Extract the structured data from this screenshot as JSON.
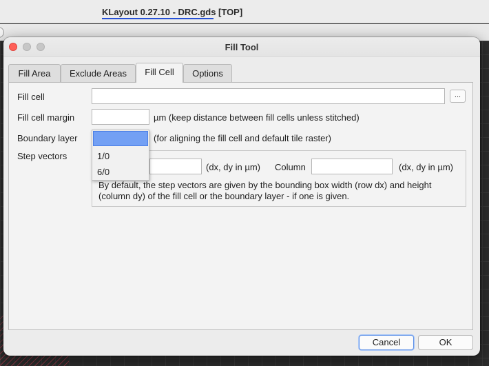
{
  "window": {
    "title": "KLayout 0.27.10 - DRC.gds [TOP]"
  },
  "dialog": {
    "title": "Fill Tool",
    "tabs": [
      "Fill Area",
      "Exclude Areas",
      "Fill Cell",
      "Options"
    ],
    "active_tab": "Fill Cell",
    "fill_cell": {
      "label": "Fill cell",
      "value": "",
      "browse_label": "..."
    },
    "fill_cell_margin": {
      "label": "Fill cell margin",
      "value": "",
      "hint": "µm (keep distance between fill cells unless stitched)"
    },
    "boundary_layer": {
      "label": "Boundary layer",
      "selected": "",
      "hint": "(for aligning the fill cell and default tile raster)",
      "options": [
        "1/0",
        "6/0"
      ]
    },
    "step_vectors": {
      "label": "Step vectors",
      "row_value": "",
      "row_units": "(dx, dy in µm)",
      "column_label": "Column",
      "column_value": "",
      "column_units": "(dx, dy in µm)",
      "note_line1": "By default, the step vectors are given by the bounding box width (row dx) and height",
      "note_line2": "(column dy) of the fill cell or the boundary layer - if one is given."
    },
    "buttons": {
      "cancel": "Cancel",
      "ok": "OK"
    }
  },
  "colors": {
    "accent": "#73a0f4",
    "close_button": "#fe5f57",
    "title_underline": "#2550d6"
  }
}
